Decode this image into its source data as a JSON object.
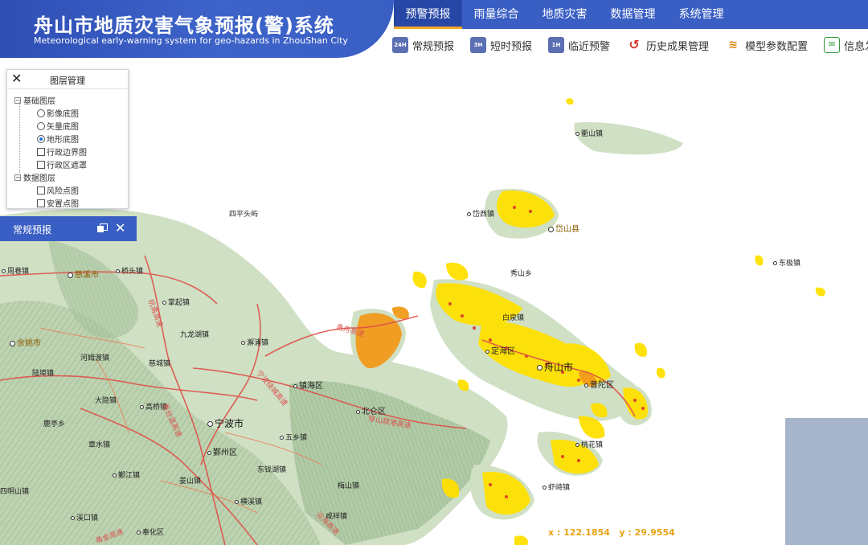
{
  "header": {
    "title": "舟山市地质灾害气象预报(警)系统",
    "subtitle": "Meteorological early-warning system for geo-hazards in ZhouShan City",
    "main_nav": [
      {
        "label": "预警预报",
        "active": true
      },
      {
        "label": "雨量综合",
        "active": false
      },
      {
        "label": "地质灾害",
        "active": false
      },
      {
        "label": "数据管理",
        "active": false
      },
      {
        "label": "系统管理",
        "active": false
      }
    ],
    "sub_nav": [
      {
        "label": "常规预报",
        "icon": "24h-clock-icon",
        "badge": "24H"
      },
      {
        "label": "短时预报",
        "icon": "3h-clock-icon",
        "badge": "3H"
      },
      {
        "label": "临近预警",
        "icon": "1h-clock-icon",
        "badge": "1H"
      },
      {
        "label": "历史成果管理",
        "icon": "history-icon",
        "badge": "↺"
      },
      {
        "label": "模型参数配置",
        "icon": "model-config-icon",
        "badge": "≋"
      },
      {
        "label": "信息发送",
        "icon": "info-send-icon",
        "badge": "✉"
      }
    ],
    "colors": {
      "brand": "#3a5fc4",
      "active_tab": "#2747a6",
      "accent": "#f5a623"
    }
  },
  "layer_panel": {
    "title": "图层管理",
    "base_group": "基础图层",
    "base_options": [
      {
        "label": "影像底图",
        "type": "radio",
        "checked": false
      },
      {
        "label": "矢量底图",
        "type": "radio",
        "checked": false
      },
      {
        "label": "地形底图",
        "type": "radio",
        "checked": true
      },
      {
        "label": "行政边界图",
        "type": "checkbox",
        "checked": false
      },
      {
        "label": "行政区遮罩",
        "type": "checkbox",
        "checked": false
      }
    ],
    "data_group": "数据图层",
    "data_options": [
      {
        "label": "风险点图",
        "type": "checkbox",
        "checked": false
      },
      {
        "label": "安置点图",
        "type": "checkbox",
        "checked": false
      }
    ]
  },
  "forecast_panel": {
    "title": "常规预报"
  },
  "map": {
    "places": {
      "qushan": "衢山镇",
      "daixi": "岱西镇",
      "daishan": "岱山县",
      "dongji": "东极镇",
      "xiushan": "秀山乡",
      "baiquan": "白泉镇",
      "dinghai": "定海区",
      "zhoushan": "舟山市",
      "putuo": "普陀区",
      "taohua": "桃花镇",
      "xiashi": "虾峙镇",
      "sipingtoukou": "四平头屿",
      "zhouxiang": "周巷镇",
      "cixi": "慈溪市",
      "qiaotou": "桥头镇",
      "zhangqi": "掌起镇",
      "jiulongh": "九龙湖镇",
      "xiepu": "澥浦镇",
      "yuyao": "余姚市",
      "hemudu": "河姆渡镇",
      "cicheng": "慈城镇",
      "luting": "陆埠镇",
      "zhenhai": "镇海区",
      "beilun": "北仑区",
      "dayin": "大隐镇",
      "gaoqiao": "高桥镇",
      "ningbo": "宁波市",
      "lutingxiang": "鹿亭乡",
      "wuxiang": "五乡镇",
      "zhangshui": "章水镇",
      "yinzhou": "鄞州区",
      "dongqianhu": "东钱湖镇",
      "yinjiang": "鄞江镇",
      "jiangshan": "姜山镇",
      "simingshan": "四明山镇",
      "hengxi": "横溪镇",
      "meishan": "梅山镇",
      "xikou": "溪口镇",
      "xianxiang": "咸祥镇",
      "fenghua": "奉化区"
    },
    "roads": {
      "yongzhou": "甬舟高速",
      "raocheng": "宁波绕城高速",
      "yongtaiwen": "甬台温高速",
      "chuanshan": "穿山疏港高速",
      "yanhai": "沿海高速",
      "hangyong": "杭甬高速",
      "yongjin": "甬金高速"
    },
    "coords": {
      "x_label": "x : ",
      "x": "122.1854",
      "y_label": "y : ",
      "y": "29.9554"
    },
    "colors": {
      "hazard_yellow": "#ffe000",
      "hazard_orange": "#f29a1b",
      "hazard_red": "#d9362b",
      "terrain": "#bdd3b0",
      "sea": "#ffffff"
    }
  }
}
